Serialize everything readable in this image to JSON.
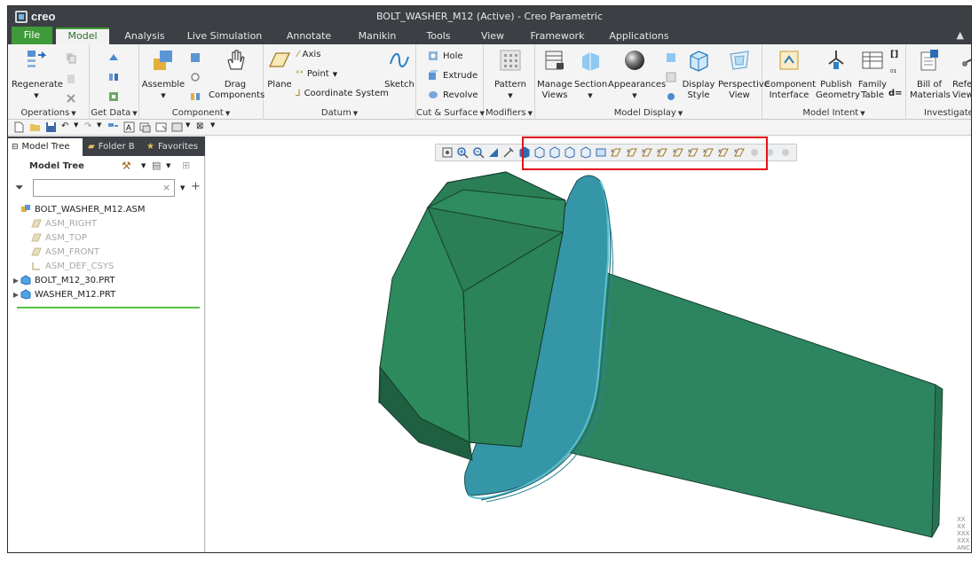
{
  "app": {
    "logo": "creo",
    "title": "BOLT_WASHER_M12 (Active) - Creo Parametric"
  },
  "ribbon_tabs": [
    "File",
    "Model",
    "Analysis",
    "Live Simulation",
    "Annotate",
    "Manikin",
    "Tools",
    "View",
    "Framework",
    "Applications"
  ],
  "active_tab": "Model",
  "ribbon": {
    "operations": {
      "label": "Operations",
      "regenerate": "Regenerate"
    },
    "get_data": {
      "label": "Get Data"
    },
    "component": {
      "label": "Component",
      "assemble": "Assemble",
      "drag": "Drag\nComponents"
    },
    "datum": {
      "label": "Datum",
      "plane": "Plane",
      "axis": "Axis",
      "point": "Point",
      "csys": "Coordinate System",
      "sketch": "Sketch"
    },
    "cut_surface": {
      "label": "Cut & Surface",
      "hole": "Hole",
      "extrude": "Extrude",
      "revolve": "Revolve"
    },
    "modifiers": {
      "label": "Modifiers",
      "pattern": "Pattern"
    },
    "model_display": {
      "label": "Model Display",
      "manage_views": "Manage\nViews",
      "section": "Section",
      "appearances": "Appearances",
      "display_style": "Display\nStyle",
      "perspective_view": "Perspective\nView"
    },
    "model_intent": {
      "label": "Model Intent",
      "component_interface": "Component\nInterface",
      "publish_geometry": "Publish\nGeometry",
      "family_table": "Family\nTable"
    },
    "investigate": {
      "label": "Investigate",
      "bill_of_materials": "Bill of\nMaterials",
      "reference_viewer": "Refer\nView"
    }
  },
  "left_panel": {
    "tabs": [
      "Model Tree",
      "Folder B",
      "Favorites"
    ],
    "model_tree_title": "Model Tree",
    "filter_placeholder": "",
    "tree": [
      {
        "label": "BOLT_WASHER_M12.ASM",
        "type": "assembly",
        "dim": false,
        "expandable": false,
        "indent": 0
      },
      {
        "label": "ASM_RIGHT",
        "type": "plane",
        "dim": true,
        "expandable": false,
        "indent": 1
      },
      {
        "label": "ASM_TOP",
        "type": "plane",
        "dim": true,
        "expandable": false,
        "indent": 1
      },
      {
        "label": "ASM_FRONT",
        "type": "plane",
        "dim": true,
        "expandable": false,
        "indent": 1
      },
      {
        "label": "ASM_DEF_CSYS",
        "type": "csys",
        "dim": true,
        "expandable": false,
        "indent": 1
      },
      {
        "label": "BOLT_M12_30.PRT",
        "type": "part",
        "dim": false,
        "expandable": true,
        "indent": 0
      },
      {
        "label": "WASHER_M12.PRT",
        "type": "part",
        "dim": false,
        "expandable": true,
        "indent": 0
      }
    ]
  },
  "graphics_toolbar": {
    "icons": [
      "refit-icon",
      "zoom-in-icon",
      "zoom-out-icon",
      "repaint-icon",
      "pan-icon",
      "shading-with-edges-icon",
      "shading-icon",
      "hidden-line-icon",
      "no-hidden-icon",
      "wireframe-icon",
      "saved-views-icon",
      "plane-display-icon",
      "axis-display-icon",
      "point-display-icon",
      "csys-display-icon",
      "plane-tag-icon",
      "axis-tag-icon",
      "point-tag-icon",
      "csys-tag-icon",
      "annotation-display-icon",
      "spin-center-icon",
      "view-manager-icon",
      "orient-icon"
    ]
  },
  "corner_marks": [
    "XX",
    "XX",
    "XXX",
    "XXX",
    "ANC"
  ],
  "colors": {
    "bolt_green": "#2a7a5a",
    "washer_teal": "#3596a8",
    "accent_green": "#3f9a3a",
    "highlight_red": "#e3121b"
  }
}
